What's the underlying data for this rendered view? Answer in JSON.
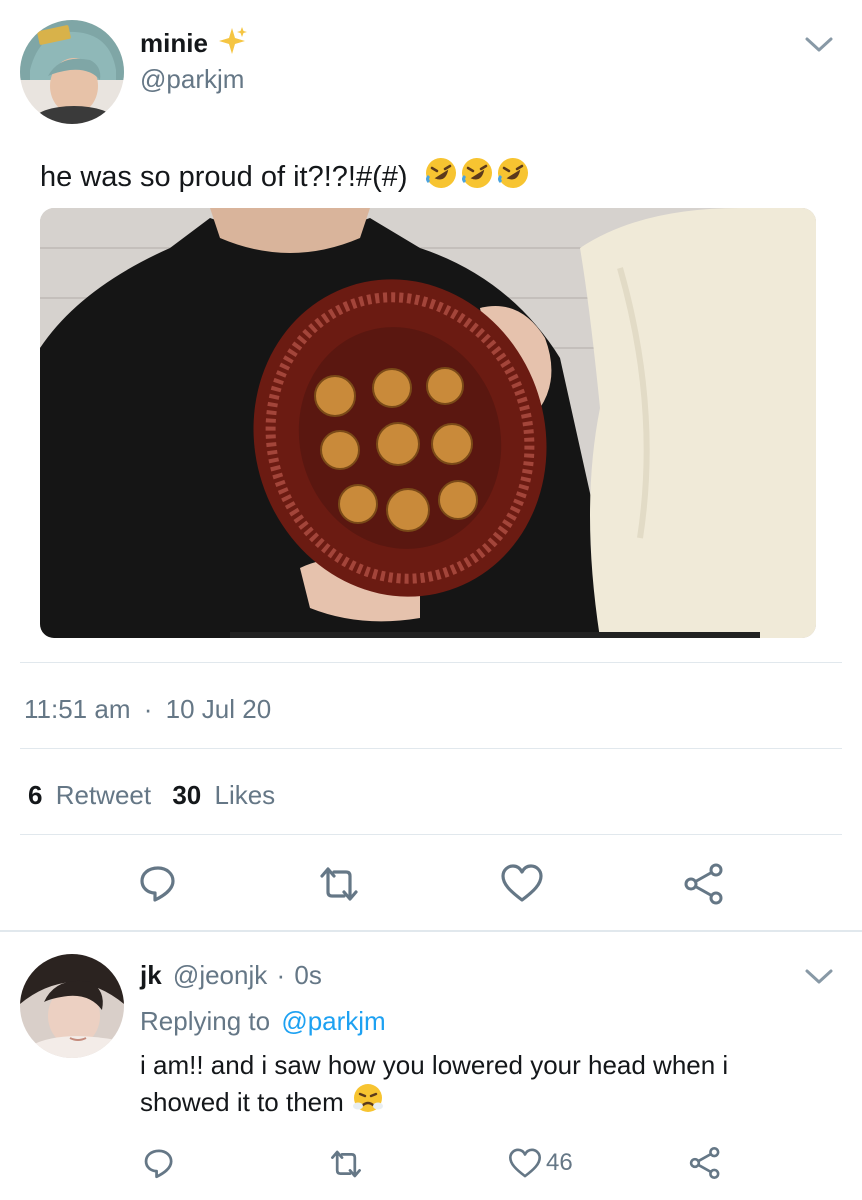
{
  "main_tweet": {
    "author_name": "minie",
    "author_handle": "@parkjm",
    "name_emoji": "sparkles-icon",
    "text": "he was so proud of it?!?!#(#)",
    "text_emojis": [
      "rolling-on-floor-laughing-emoji",
      "rolling-on-floor-laughing-emoji",
      "rolling-on-floor-laughing-emoji"
    ],
    "time": "11:51 am",
    "date": "10 Jul 20",
    "separator": "·",
    "retweet_count": "6",
    "retweet_label": "Retweet",
    "likes_count": "30",
    "likes_label": "Likes"
  },
  "reply_tweet": {
    "author_name": "jk",
    "author_handle": "@jeonjk",
    "separator": "·",
    "time_ago": "0s",
    "replying_prefix": "Replying to",
    "replying_to": "@parkjm",
    "text_line1": "i am!! and i saw how you lowered your head when i",
    "text_line2": "showed it to them",
    "text_emoji": "face-with-steam-from-nose-emoji",
    "like_count": "46"
  },
  "colors": {
    "text_primary": "#14171a",
    "text_secondary": "#657786",
    "link": "#1da1f2",
    "divider": "#e1e8ed",
    "sparkle": "#f5c542"
  }
}
